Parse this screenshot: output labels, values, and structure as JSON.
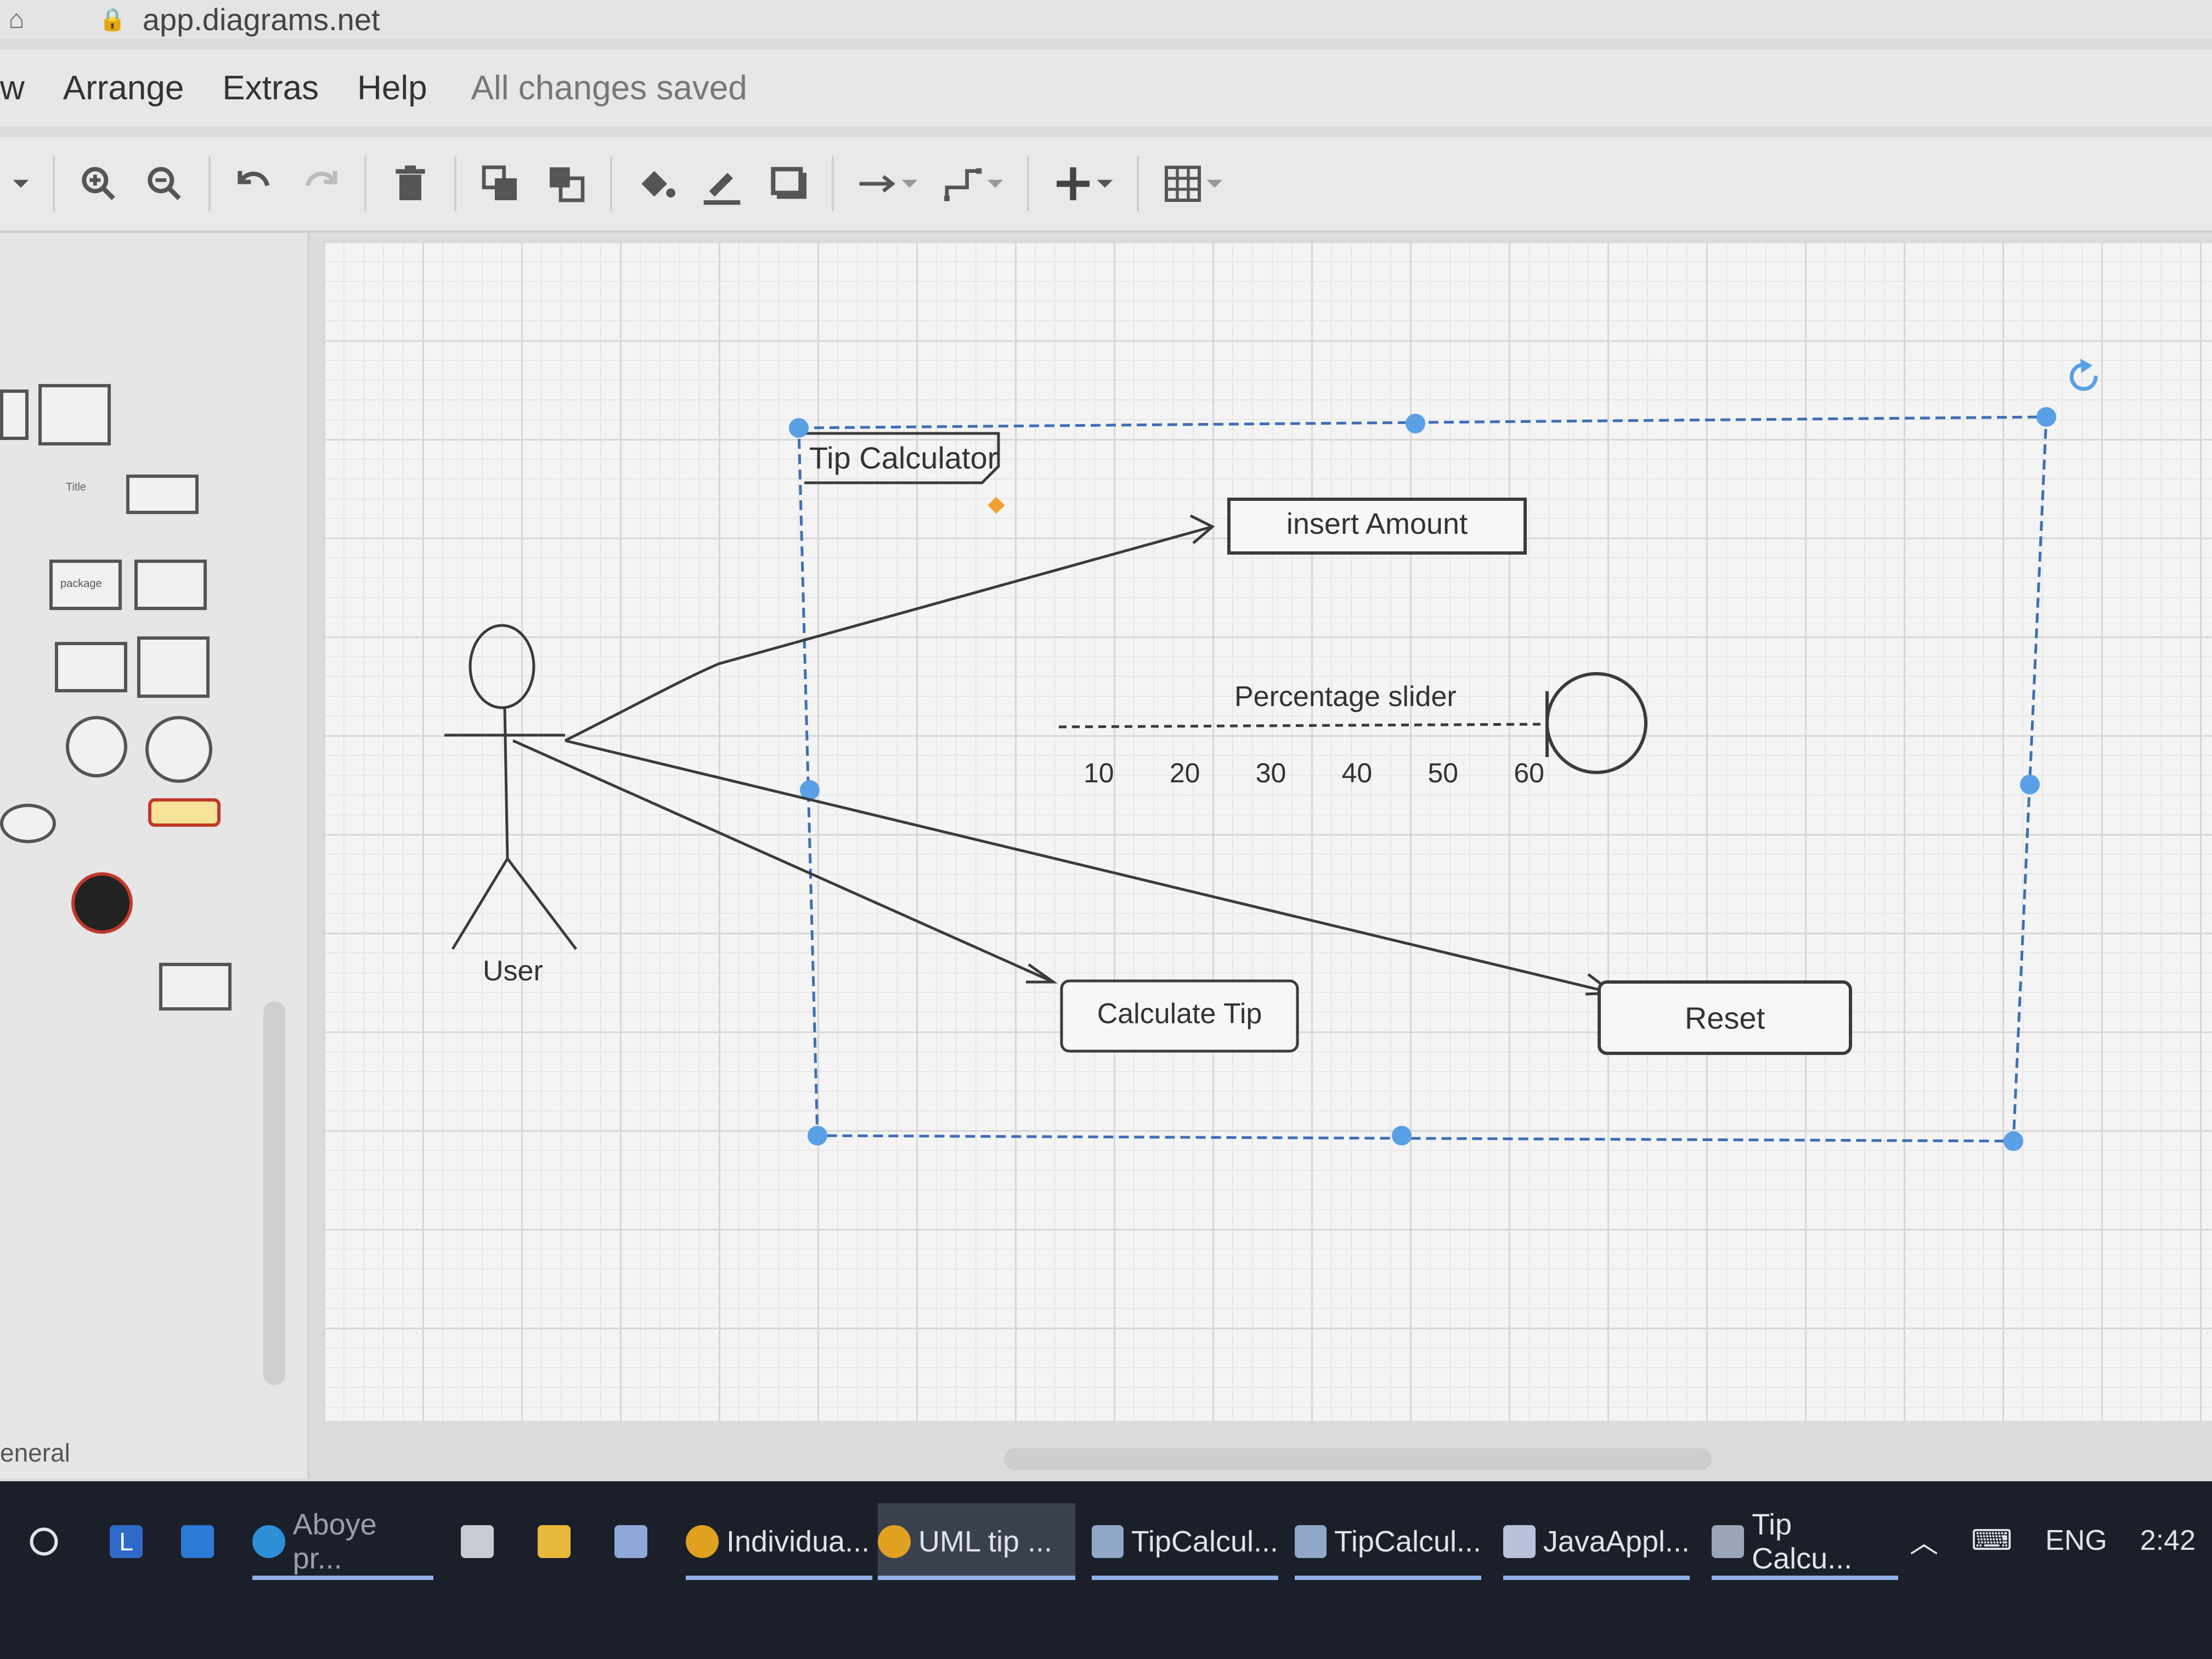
{
  "browser": {
    "url": "app.diagrams.net"
  },
  "menubar": {
    "items": [
      "w",
      "Arrange",
      "Extras",
      "Help"
    ],
    "status": "All changes saved"
  },
  "diagram": {
    "frame_title": "Tip Calculator",
    "actor_label": "User",
    "boxes": {
      "insert_amount": "insert Amount",
      "calculate_tip": "Calculate Tip",
      "reset": "Reset"
    },
    "slider": {
      "label": "Percentage slider",
      "ticks": [
        "10",
        "20",
        "30",
        "40",
        "50",
        "60"
      ]
    }
  },
  "sidebar": {
    "section_label": "eneral",
    "mini_labels": [
      "Title",
      "package"
    ]
  },
  "taskbar": {
    "items": [
      {
        "label": ""
      },
      {
        "label": "L"
      },
      {
        "label": ""
      },
      {
        "label": "Aboye pr..."
      },
      {
        "label": ""
      },
      {
        "label": ""
      },
      {
        "label": ""
      },
      {
        "label": "Individua..."
      },
      {
        "label": "UML tip ..."
      },
      {
        "label": "TipCalcul..."
      },
      {
        "label": "TipCalcul..."
      },
      {
        "label": "JavaAppl..."
      },
      {
        "label": "Tip Calcu..."
      }
    ],
    "tray": {
      "lang": "ENG",
      "time": "2:42"
    }
  },
  "colors": {
    "accent_blue": "#5aa0e6",
    "diagram_line": "#3b3b3b",
    "taskbar_bg": "#1b1f2a"
  }
}
